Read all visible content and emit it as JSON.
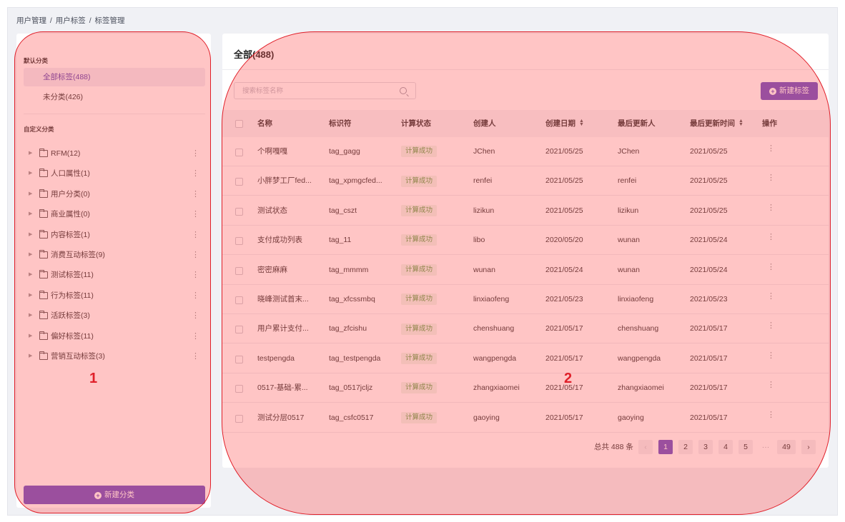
{
  "breadcrumb": [
    "用户管理",
    "/",
    "用户标签",
    "/",
    "标签管理"
  ],
  "sidebar": {
    "default_section_title": "默认分类",
    "default_items": [
      {
        "label": "全部标签(488)",
        "active": true
      },
      {
        "label": "未分类(426)",
        "active": false
      }
    ],
    "custom_section_title": "自定义分类",
    "custom_items": [
      {
        "label": "RFM(12)"
      },
      {
        "label": "人口属性(1)"
      },
      {
        "label": "用户分类(0)"
      },
      {
        "label": "商业属性(0)"
      },
      {
        "label": "内容标签(1)"
      },
      {
        "label": "消费互动标签(9)"
      },
      {
        "label": "测试标签(11)"
      },
      {
        "label": "行为标签(11)"
      },
      {
        "label": "活跃标签(3)"
      },
      {
        "label": "偏好标签(11)"
      },
      {
        "label": "营销互动标签(3)"
      }
    ],
    "more_glyph": "⋮",
    "new_category_label": "新建分类"
  },
  "main": {
    "title": "全部(488)",
    "search_placeholder": "搜索标签名称",
    "new_tag_label": "新建标签",
    "columns": [
      "名称",
      "标识符",
      "计算状态",
      "创建人",
      "创建日期",
      "最后更新人",
      "最后更新时间",
      "操作"
    ],
    "sortable_columns": [
      "创建日期",
      "最后更新时间"
    ],
    "rows": [
      {
        "name": "个啊嘎嘎",
        "code": "tag_gagg",
        "status": "计算成功",
        "creator": "JChen",
        "created": "2021/05/25",
        "updater": "JChen",
        "updated": "2021/05/25"
      },
      {
        "name": "小胖梦工厂fed...",
        "code": "tag_xpmgcfed...",
        "status": "计算成功",
        "creator": "renfei",
        "created": "2021/05/25",
        "updater": "renfei",
        "updated": "2021/05/25"
      },
      {
        "name": "测试状态",
        "code": "tag_cszt",
        "status": "计算成功",
        "creator": "lizikun",
        "created": "2021/05/25",
        "updater": "lizikun",
        "updated": "2021/05/25"
      },
      {
        "name": "支付成功列表",
        "code": "tag_11",
        "status": "计算成功",
        "creator": "libo",
        "created": "2020/05/20",
        "updater": "wunan",
        "updated": "2021/05/24"
      },
      {
        "name": "密密麻麻",
        "code": "tag_mmmm",
        "status": "计算成功",
        "creator": "wunan",
        "created": "2021/05/24",
        "updater": "wunan",
        "updated": "2021/05/24"
      },
      {
        "name": "晓峰测试首末...",
        "code": "tag_xfcssmbq",
        "status": "计算成功",
        "creator": "linxiaofeng",
        "created": "2021/05/23",
        "updater": "linxiaofeng",
        "updated": "2021/05/23"
      },
      {
        "name": "用户累计支付...",
        "code": "tag_zfcishu",
        "status": "计算成功",
        "creator": "chenshuang",
        "created": "2021/05/17",
        "updater": "chenshuang",
        "updated": "2021/05/17"
      },
      {
        "name": "testpengda",
        "code": "tag_testpengda",
        "status": "计算成功",
        "creator": "wangpengda",
        "created": "2021/05/17",
        "updater": "wangpengda",
        "updated": "2021/05/17"
      },
      {
        "name": "0517-基础-累...",
        "code": "tag_0517jcljz",
        "status": "计算成功",
        "creator": "zhangxiaomei",
        "created": "2021/05/17",
        "updater": "zhangxiaomei",
        "updated": "2021/05/17"
      },
      {
        "name": "测试分层0517",
        "code": "tag_csfc0517",
        "status": "计算成功",
        "creator": "gaoying",
        "created": "2021/05/17",
        "updater": "gaoying",
        "updated": "2021/05/17"
      }
    ],
    "pagination": {
      "total_text": "总共 488 条",
      "pages": [
        "1",
        "2",
        "3",
        "4",
        "5"
      ],
      "current_page": "1",
      "ellipsis": "···",
      "last_page": "49",
      "prev_glyph": "‹",
      "next_glyph": "›"
    }
  },
  "annotations": {
    "region_1_label": "1",
    "region_2_label": "2",
    "overlay_color": "#e0202a"
  },
  "colors": {
    "accent": "#6b4fc5",
    "status_success": "#5aa04a"
  }
}
